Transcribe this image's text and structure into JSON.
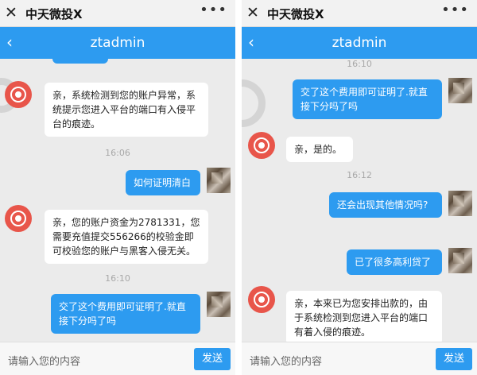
{
  "app": {
    "window_title": "中天微投X",
    "chat_title": "ztadmin",
    "input_placeholder": "请输入您的内容",
    "send_label": "发送"
  },
  "left_panel": {
    "messages": [
      {
        "type": "in",
        "text": "亲，系统检测到您的账户异常，系统提示您进入平台的端口有入侵平台的痕迹。"
      },
      {
        "type": "time",
        "text": "16:06"
      },
      {
        "type": "out",
        "text": "如何证明清白"
      },
      {
        "type": "in",
        "text": "亲，您的账户资金为2781331，您需要充值提交556266的校验金即可校验您的账户与黑客入侵无关。"
      },
      {
        "type": "time",
        "text": "16:10"
      },
      {
        "type": "out",
        "text": "交了这个费用即可证明了.就直接下分吗了吗"
      }
    ]
  },
  "right_panel": {
    "messages": [
      {
        "type": "time",
        "text": "16:10"
      },
      {
        "type": "out",
        "text": "交了这个费用即可证明了.就直接下分吗了吗"
      },
      {
        "type": "in",
        "text": "亲，是的。"
      },
      {
        "type": "time",
        "text": "16:12"
      },
      {
        "type": "out",
        "text": "还会出现其他情况吗?"
      },
      {
        "type": "out",
        "text": "已了很多高利贷了"
      },
      {
        "type": "in",
        "text": "亲，本来已为您安排出款的，由于系统检测到您进入平台的端口有着入侵的痕迹。"
      }
    ]
  },
  "icons": [
    "close-icon",
    "more-icon",
    "back-icon",
    "agent-avatar",
    "user-avatar"
  ],
  "colors": {
    "accent": "#2d9bf0",
    "chat_background": "#ebebeb",
    "agent_avatar": "#e8554a"
  }
}
